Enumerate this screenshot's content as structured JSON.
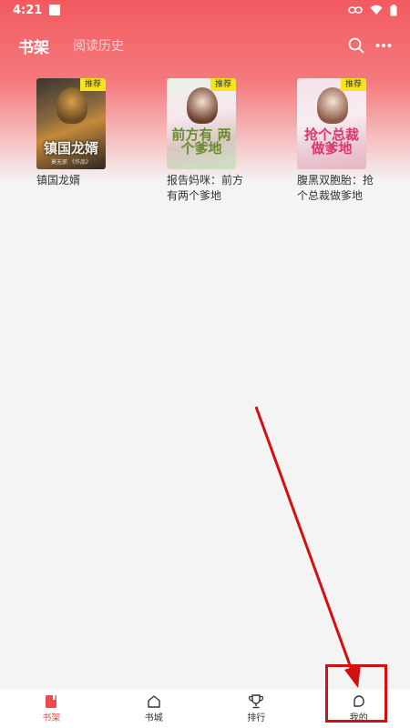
{
  "status_bar": {
    "time": "4:21"
  },
  "header": {
    "tab_active": "书架",
    "tab_inactive": "阅读历史",
    "icons": [
      "search-icon",
      "more-icon"
    ]
  },
  "shelf": {
    "badge": "推荐",
    "books": [
      {
        "title": "镇国龙婿",
        "cover_title": "镇国龙婿",
        "cover_author": "莫无邪 《作品》"
      },
      {
        "title": "报告妈咪：前方有两个爹地",
        "cover_title": "前方有 两个爹地"
      },
      {
        "title": "腹黑双胞胎：抢个总裁做爹地",
        "cover_title": "抢个总裁 做爹地"
      }
    ]
  },
  "bottom_nav": {
    "items": [
      {
        "label": "书架",
        "icon": "bookshelf-icon",
        "active": true
      },
      {
        "label": "书城",
        "icon": "home-icon",
        "active": false
      },
      {
        "label": "排行",
        "icon": "trophy-icon",
        "active": false
      },
      {
        "label": "我的",
        "icon": "profile-icon",
        "active": false
      }
    ]
  },
  "colors": {
    "accent": "#e94b50",
    "header_gradient_top": "#f25a5f",
    "badge": "#f7e31e",
    "annotation": "#d40f0f"
  }
}
